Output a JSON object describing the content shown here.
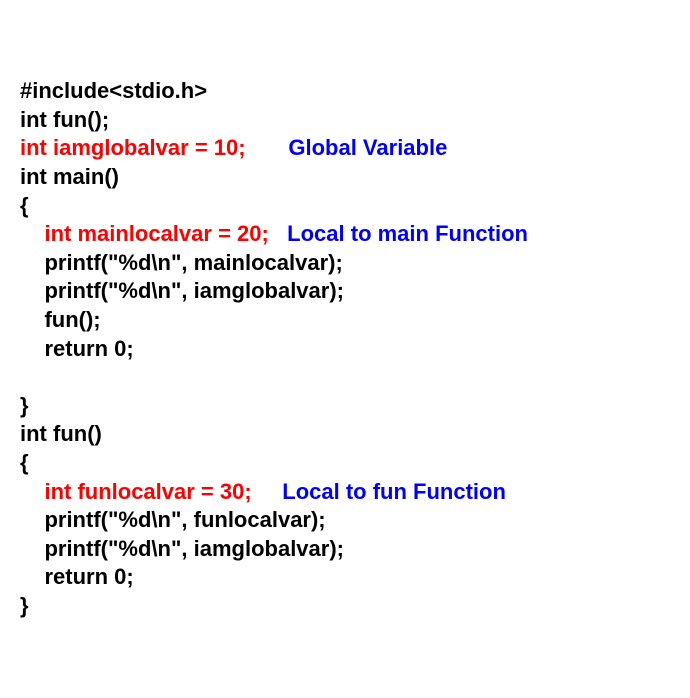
{
  "code": {
    "l1": "#include<stdio.h>",
    "l2": "int fun();",
    "l3_red": "int iamglobalvar = 10;",
    "l3_blue": "Global Variable",
    "l4": "int main()",
    "l5": "{",
    "l6_indent": "    ",
    "l6_red": "int mainlocalvar = 20;",
    "l6_blue": "Local to main Function",
    "l7": "    printf(\"%d\\n\", mainlocalvar);",
    "l8": "    printf(\"%d\\n\", iamglobalvar);",
    "l9": "    fun();",
    "l10": "    return 0;",
    "l11": "",
    "l12": "}",
    "l13": "int fun()",
    "l14": "{",
    "l15_indent": "    ",
    "l15_red": "int funlocalvar = 30;",
    "l15_blue": "Local to fun Function",
    "l16": "    printf(\"%d\\n\", funlocalvar);",
    "l17": "    printf(\"%d\\n\", iamglobalvar);",
    "l18": "    return 0;",
    "l19": "}"
  }
}
